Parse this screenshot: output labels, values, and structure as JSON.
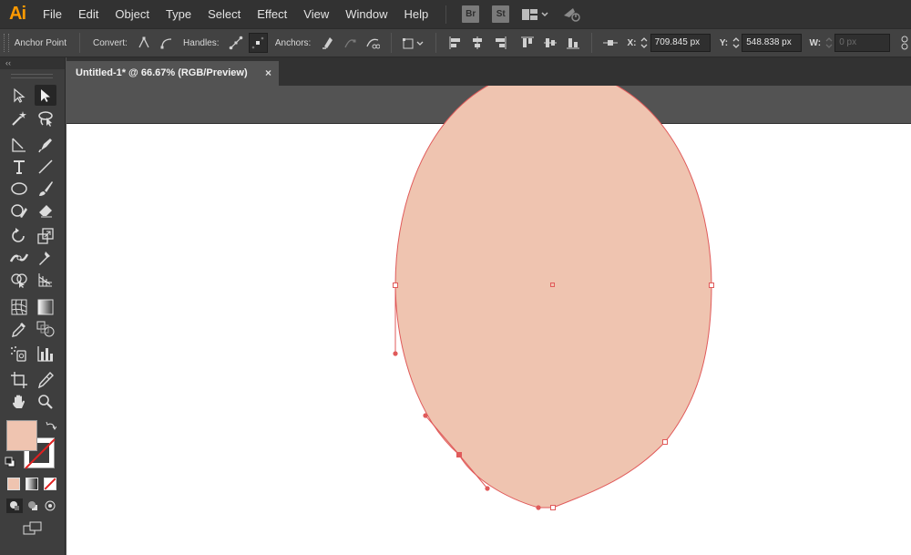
{
  "app": {
    "logo": "Ai",
    "menus": [
      "File",
      "Edit",
      "Object",
      "Type",
      "Select",
      "Effect",
      "View",
      "Window",
      "Help"
    ],
    "bridge_buttons": [
      "Br",
      "St"
    ]
  },
  "controlbar": {
    "tool_name": "Anchor Point",
    "convert_label": "Convert:",
    "handles_label": "Handles:",
    "anchors_label": "Anchors:",
    "x_label": "X:",
    "x_value": "709.845 px",
    "y_label": "Y:",
    "y_value": "548.838 px",
    "w_label": "W:",
    "w_value": "0 px"
  },
  "tools_panel": {
    "collapse_glyph": "‹‹"
  },
  "document": {
    "tab_title": "Untitled-1* @ 66.67% (RGB/Preview)",
    "close_glyph": "×"
  },
  "colors": {
    "fill": "#efc4b0",
    "stroke": "#e05a5a",
    "app_accent": "#ff9a00"
  }
}
